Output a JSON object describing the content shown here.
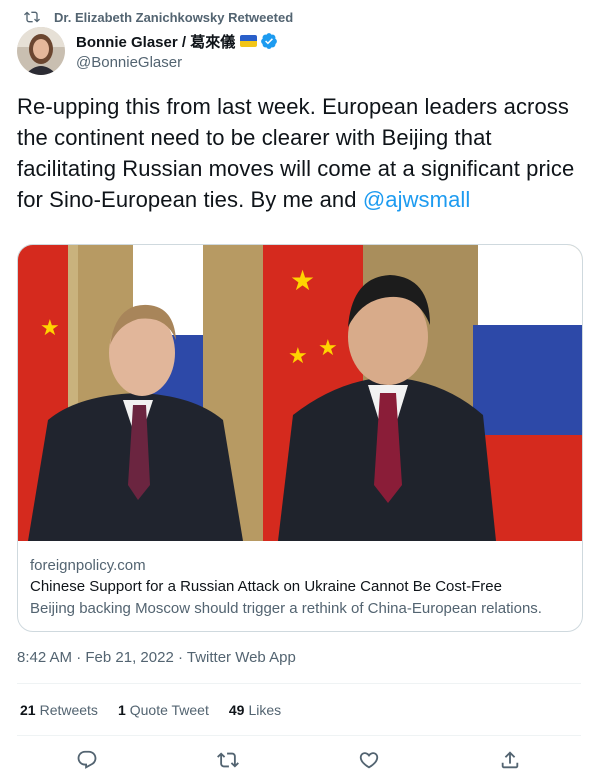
{
  "retweet": {
    "label": "Dr. Elizabeth Zanichkowsky Retweeted",
    "icon": "retweet-icon"
  },
  "author": {
    "name": "Bonnie Glaser / 葛來儀",
    "handle": "@BonnieGlaser",
    "verified": true,
    "flag": "ukraine-flag"
  },
  "tweet": {
    "text": "Re-upping this from last week. European leaders across the continent need to be clearer with Beijing that facilitating Russian moves will come at a significant price for Sino-European ties. By me and ",
    "mention": "@ajwsmall"
  },
  "card": {
    "domain": "foreignpolicy.com",
    "title": "Chinese Support for a Russian Attack on Ukraine Cannot Be Cost-Free",
    "description": "Beijing backing Moscow should trigger a rethink of China-European relations."
  },
  "meta": {
    "time": "8:42 AM",
    "date": "Feb 21, 2022",
    "client": "Twitter Web App",
    "sep": " · "
  },
  "stats": {
    "retweets": {
      "count": "21",
      "label": "Retweets"
    },
    "quotes": {
      "count": "1",
      "label": "Quote Tweet"
    },
    "likes": {
      "count": "49",
      "label": "Likes"
    }
  },
  "actions": [
    "reply-icon",
    "retweet-icon",
    "like-icon",
    "share-icon"
  ],
  "colors": {
    "accent": "#1d9bf0",
    "muted": "#536471",
    "text": "#0f1419",
    "border": "#cfd9de"
  }
}
